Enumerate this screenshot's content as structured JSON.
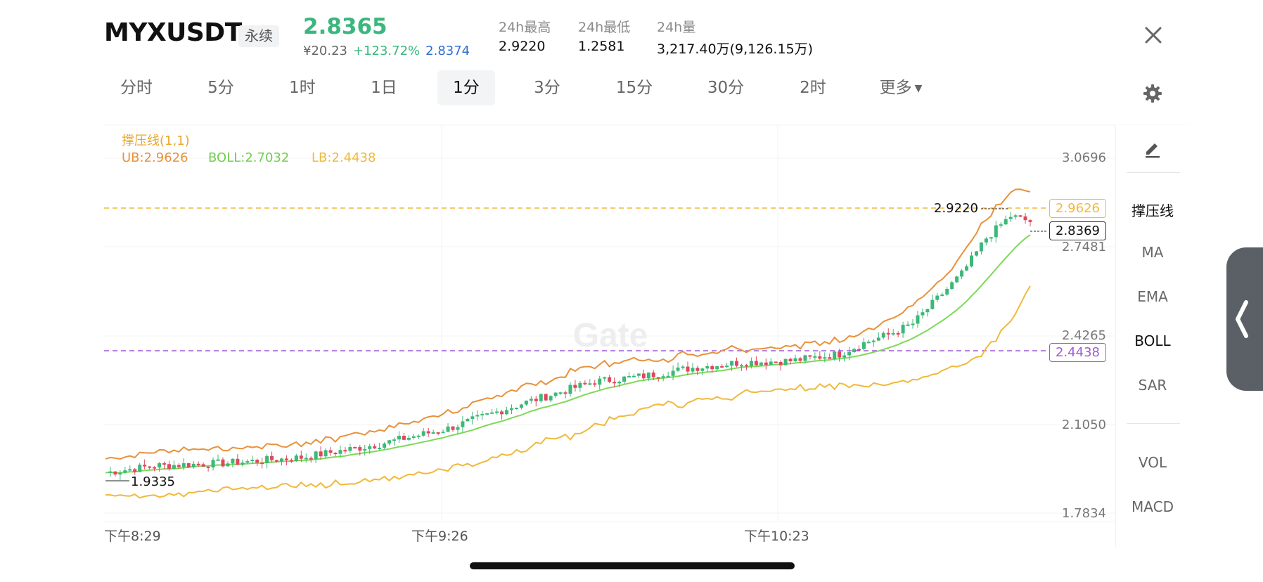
{
  "header": {
    "symbol": "MYXUSDT",
    "badge": "永续",
    "last_price": "2.8365",
    "cny_price": "¥20.23",
    "change_pct": "+123.72%",
    "mark_price": "2.8374",
    "stats": [
      {
        "label": "24h最高",
        "value": "2.9220"
      },
      {
        "label": "24h最低",
        "value": "1.2581"
      },
      {
        "label": "24h量",
        "value": "3,217.40万(9,126.15万)"
      }
    ]
  },
  "tabs": [
    {
      "label": "分时",
      "active": false
    },
    {
      "label": "5分",
      "active": false
    },
    {
      "label": "1时",
      "active": false
    },
    {
      "label": "1日",
      "active": false
    },
    {
      "label": "1分",
      "active": true
    },
    {
      "label": "3分",
      "active": false
    },
    {
      "label": "15分",
      "active": false
    },
    {
      "label": "30分",
      "active": false
    },
    {
      "label": "2时",
      "active": false
    },
    {
      "label": "更多",
      "active": false
    }
  ],
  "indicator_legend": {
    "title": "撑压线(1,1)",
    "ub": "UB:2.9626",
    "boll": "BOLL:2.7032",
    "lb": "LB:2.4438"
  },
  "chart_data": {
    "type": "candlestick",
    "y_axis_ticks": [
      "3.0696",
      "2.7481",
      "2.4265",
      "2.1050",
      "1.7834"
    ],
    "ylim": [
      1.7834,
      3.0696
    ],
    "x_axis_ticks": [
      "下午8:29",
      "下午9:26",
      "下午10:23"
    ],
    "tags": {
      "ub": "2.9626",
      "current": "2.8369",
      "lb": "2.4438"
    },
    "high_marker": "2.9220",
    "low_marker": "1.9335",
    "watermark": "Gate"
  },
  "side_panel": {
    "items": [
      "撑压线",
      "MA",
      "EMA",
      "BOLL",
      "SAR"
    ],
    "items2": [
      "VOL",
      "MACD"
    ],
    "active": [
      "撑压线",
      "BOLL"
    ]
  },
  "colors": {
    "up": "#3cb878",
    "down": "#e0475e",
    "ub": "#e8913a",
    "mid": "#7ed957",
    "lb": "#f0b93a",
    "lb_line": "#a05ad8"
  }
}
